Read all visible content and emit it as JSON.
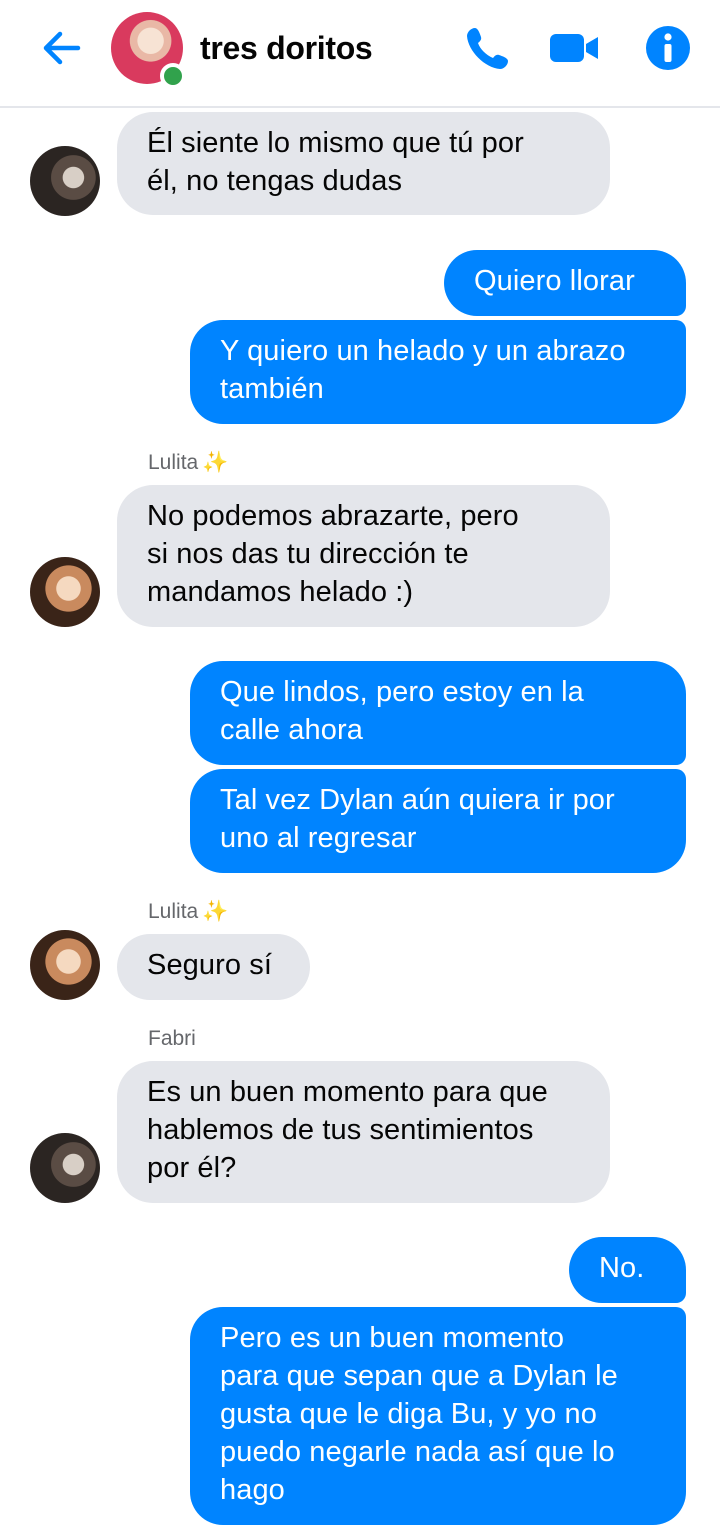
{
  "header": {
    "title": "tres doritos",
    "icons": {
      "back": "arrow-left-icon",
      "phone": "phone-icon",
      "video": "video-camera-icon",
      "info": "info-icon"
    },
    "accent_color": "#0084ff",
    "online_color": "#31a24c"
  },
  "messages": [
    {
      "side": "in",
      "avatar": "fabri",
      "text": "Él siente lo mismo que tú por\nél, no tengas dudas"
    },
    {
      "side": "out",
      "text": "Quiero llorar"
    },
    {
      "side": "out",
      "text": "Y quiero un helado y un abrazo\ntambién"
    },
    {
      "side": "in",
      "sender": "Lulita",
      "sender_emoji": "✨",
      "avatar": "lulita",
      "text": "No podemos abrazarte, pero\nsi nos das tu dirección te\nmandamos helado :)"
    },
    {
      "side": "out",
      "text": "Que lindos, pero estoy en la\ncalle ahora"
    },
    {
      "side": "out",
      "text": "Tal vez Dylan aún quiera ir por\nuno al regresar"
    },
    {
      "side": "in",
      "sender": "Lulita",
      "sender_emoji": "✨",
      "avatar": "lulita",
      "text": "Seguro sí"
    },
    {
      "side": "in",
      "sender": "Fabri",
      "avatar": "fabri",
      "text": "Es un buen momento para que\nhablemos de tus sentimientos\npor él?"
    },
    {
      "side": "out",
      "text": "No."
    },
    {
      "side": "out",
      "text": "Pero es un buen momento\npara que sepan que a Dylan le\ngusta que le diga Bu, y yo no\npuedo negarle nada así que lo\nhago"
    }
  ],
  "colors": {
    "incoming_bubble": "#e4e6eb",
    "outgoing_bubble": "#0084ff",
    "sender_name": "#65676b"
  }
}
